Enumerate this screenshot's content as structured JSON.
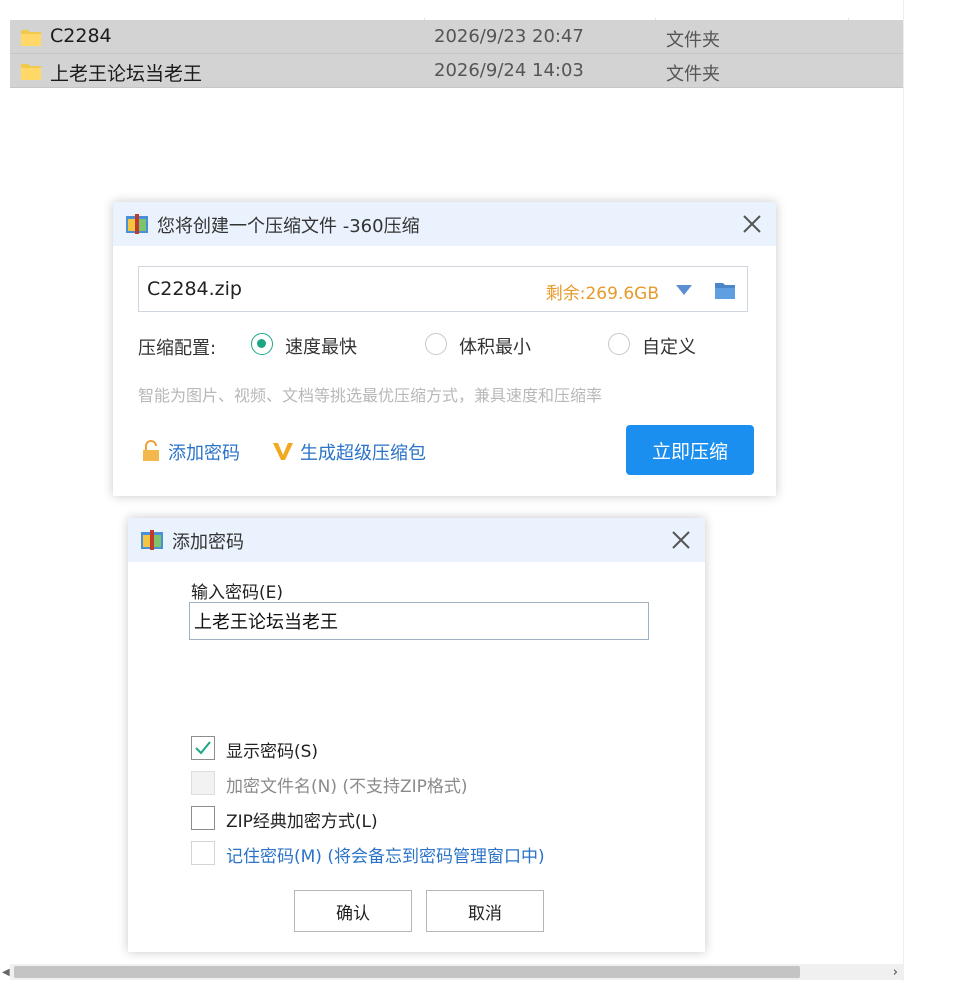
{
  "file_list": {
    "rows": [
      {
        "name": "C2284",
        "date": "2026/9/23 20:47",
        "type": "文件夹"
      },
      {
        "name": "上老王论坛当老王",
        "date": "2026/9/24 14:03",
        "type": "文件夹"
      }
    ]
  },
  "compress_dialog": {
    "title": "您将创建一个压缩文件 -360压缩",
    "path_value": "C2284.zip",
    "remaining": "剩余:269.6GB",
    "config_label": "压缩配置:",
    "options": [
      "速度最快",
      "体积最小",
      "自定义"
    ],
    "selected_option": "速度最快",
    "hint": "智能为图片、视频、文档等挑选最优压缩方式，兼具速度和压缩率",
    "add_password_link": "添加密码",
    "super_package_link": "生成超级压缩包",
    "compress_button": "立即压缩"
  },
  "password_dialog": {
    "title": "添加密码",
    "input_label": "输入密码(E)",
    "password_value": "上老王论坛当老王",
    "checkboxes": [
      {
        "label": "显示密码(S)",
        "checked": true,
        "enabled": true
      },
      {
        "label": "加密文件名(N) (不支持ZIP格式)",
        "checked": false,
        "enabled": false
      },
      {
        "label": "ZIP经典加密方式(L)",
        "checked": false,
        "enabled": true
      },
      {
        "label": "记住密码(M) (将会备忘到密码管理窗口中)",
        "checked": false,
        "enabled": true
      }
    ],
    "ok_button": "确认",
    "cancel_button": "取消"
  },
  "colors": {
    "accent": "#1a8ff0",
    "checked_green": "#1ba784",
    "remaining_orange": "#e79a2b",
    "link_blue": "#2a73c8",
    "titlebar": "#eaf3fd",
    "row_selected": "#d3d3d3"
  },
  "icons": {
    "folder": "folder-icon",
    "app": "archive-app-icon",
    "close": "close-icon",
    "dropdown": "dropdown-arrow-icon",
    "browse": "browse-folder-icon",
    "lock": "lock-icon",
    "v": "vip-v-icon"
  }
}
